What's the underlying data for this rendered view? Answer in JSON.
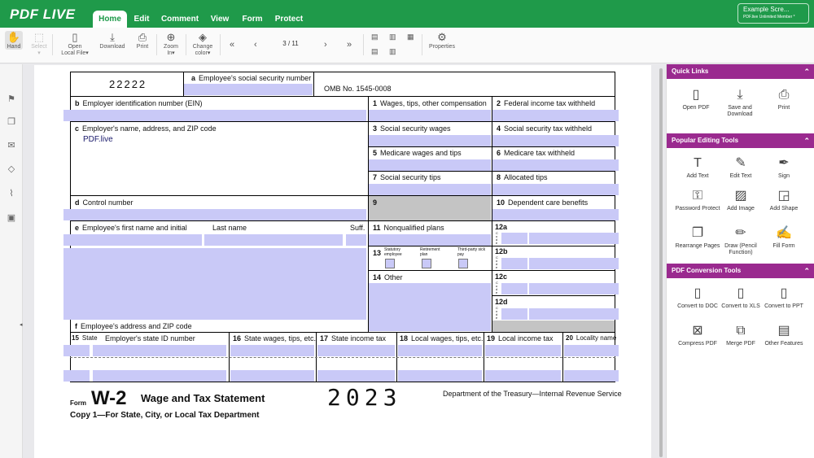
{
  "app": {
    "logo": "PDF LIVE"
  },
  "tabs": [
    "Home",
    "Edit",
    "Comment",
    "View",
    "Form",
    "Protect"
  ],
  "user": {
    "name": "Example Scre...",
    "membership": "PDF.live Unlimited Member *"
  },
  "toolbar": {
    "hand": "Hand",
    "select": "Select",
    "open_l1": "Open",
    "open_l2": "Local File",
    "download": "Download",
    "print": "Print",
    "zoom_l1": "Zoom",
    "zoom_l2": "In",
    "color_l1": "Change",
    "color_l2": "color",
    "page": "3 / 11",
    "properties": "Properties"
  },
  "form": {
    "box22222": "22222",
    "a": "a",
    "a_label": "Employee's social security number",
    "omb": "OMB No. 1545-0008",
    "b": "b",
    "b_label": "Employer identification number (EIN)",
    "c": "c",
    "c_label": "Employer's name, address, and ZIP code",
    "c_value": "PDF.live",
    "d": "d",
    "d_label": "Control number",
    "e": "e",
    "e_label": "Employee's first name and initial",
    "last": "Last name",
    "suff": "Suff.",
    "f": "f",
    "f_label": "Employee's address and ZIP code",
    "b1": "1",
    "b1_label": "Wages, tips, other compensation",
    "b2": "2",
    "b2_label": "Federal income tax withheld",
    "b3": "3",
    "b3_label": "Social security wages",
    "b4": "4",
    "b4_label": "Social security tax withheld",
    "b5": "5",
    "b5_label": "Medicare wages and tips",
    "b6": "6",
    "b6_label": "Medicare tax withheld",
    "b7": "7",
    "b7_label": "Social security tips",
    "b8": "8",
    "b8_label": "Allocated tips",
    "b9": "9",
    "b10": "10",
    "b10_label": "Dependent care benefits",
    "b11": "11",
    "b11_label": "Nonqualified plans",
    "b12a": "12a",
    "b12b": "12b",
    "b12c": "12c",
    "b12d": "12d",
    "code": "C o d e",
    "b13": "13",
    "statutory": "Statutory employee",
    "retirement": "Retirement plan",
    "thirdparty": "Third-party sick pay",
    "b14": "14",
    "b14_label": "Other",
    "b15": "15",
    "b15_label": "State",
    "b15_id": "Employer's state ID number",
    "b16": "16",
    "b16_label": "State wages, tips, etc.",
    "b17": "17",
    "b17_label": "State income tax",
    "b18": "18",
    "b18_label": "Local wages, tips, etc.",
    "b19": "19",
    "b19_label": "Local income tax",
    "b20": "20",
    "b20_label": "Locality name",
    "form_word": "Form",
    "form_name": "W-2",
    "form_title": "Wage and Tax Statement",
    "year": "2023",
    "dept": "Department of the Treasury—Internal Revenue Service",
    "copy": "Copy 1—For State, City, or Local Tax Department"
  },
  "panel": {
    "quick_links": "Quick Links",
    "q": [
      "Open PDF",
      "Save and Download",
      "Print"
    ],
    "popular": "Popular Editing Tools",
    "p": [
      "Add Text",
      "Edit Text",
      "Sign",
      "Password Protect",
      "Add Image",
      "Add Shape",
      "Rearrange Pages",
      "Draw (Pencil Function)",
      "Fill Form"
    ],
    "conversion": "PDF Conversion Tools",
    "c": [
      "Convert to DOC",
      "Convert to XLS",
      "Convert to PPT",
      "Compress PDF",
      "Merge PDF",
      "Other Features"
    ]
  },
  "colors": {
    "brand_green": "#1f9a4a",
    "panel_purple": "#9a2a8f",
    "field_fill": "#c9c9f7"
  }
}
